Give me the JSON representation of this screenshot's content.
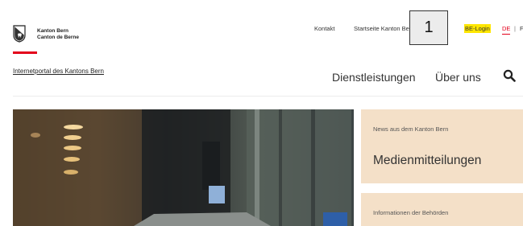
{
  "brand": {
    "name_de": "Kanton Bern",
    "name_fr": "Canton de Berne",
    "logo_icon": "bern-coat-of-arms-icon",
    "accent_color": "#e3001b"
  },
  "utility_nav": {
    "kontakt": "Kontakt",
    "startseite": "Startseite Kanton Be",
    "be_login": "BE-Login",
    "be_login_highlight": "#ffe600",
    "lang_active": "DE",
    "lang_separator": "|",
    "lang_other": "F"
  },
  "overlay": {
    "badge": "1"
  },
  "portal_link": "Internetportal des Kantons Bern",
  "main_nav": {
    "items": [
      "Dienstleistungen",
      "Über uns"
    ],
    "search_icon": "search-icon"
  },
  "cards": [
    {
      "kicker": "News aus dem Kanton Bern",
      "title": "Medienmitteilungen"
    },
    {
      "kicker": "Informationen der Behörden",
      "title": ""
    }
  ],
  "colors": {
    "card_bg": "#f4e0c8"
  }
}
